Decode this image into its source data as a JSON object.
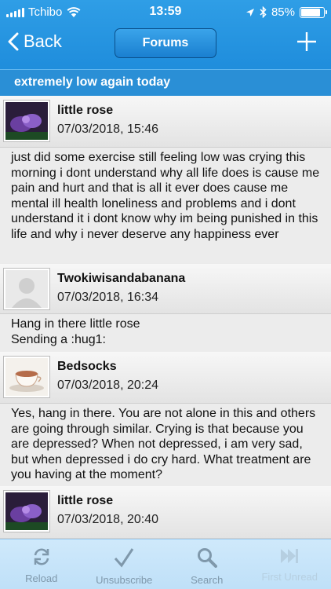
{
  "status": {
    "carrier": "Tchibo",
    "time": "13:59",
    "battery": "85%",
    "battery_level": 0.85
  },
  "nav": {
    "back_label": "Back",
    "title": "Forums"
  },
  "thread": {
    "title": "extremely low again today"
  },
  "posts": [
    {
      "author": "little rose",
      "date": "07/03/2018, 15:46",
      "body": "just did some exercise still feeling low was crying this morning i dont understand why all life does is cause me pain and hurt and that is all it ever does cause me mental ill health loneliness and problems and i dont understand it i dont know why im being punished in this life and why i never deserve any happiness ever"
    },
    {
      "author": "Twokiwisandabanana",
      "date": "07/03/2018, 16:34",
      "body_lines": [
        "Hang in there little rose",
        "Sending a :hug1:"
      ]
    },
    {
      "author": "Bedsocks",
      "date": "07/03/2018, 20:24",
      "body": "Yes, hang in there. You are not alone in this and others are going through similar. Crying is that because you are depressed? When not depressed, i am very sad, but when depressed i do cry hard. What treatment are you having at the moment?"
    },
    {
      "author": "little rose",
      "date": "07/03/2018, 20:40"
    }
  ],
  "tabs": [
    {
      "label": "Reload",
      "icon": "reload-icon"
    },
    {
      "label": "Unsubscribe",
      "icon": "checkmark-icon"
    },
    {
      "label": "Search",
      "icon": "search-icon"
    },
    {
      "label": "First Unread",
      "icon": "skip-forward-icon"
    }
  ]
}
